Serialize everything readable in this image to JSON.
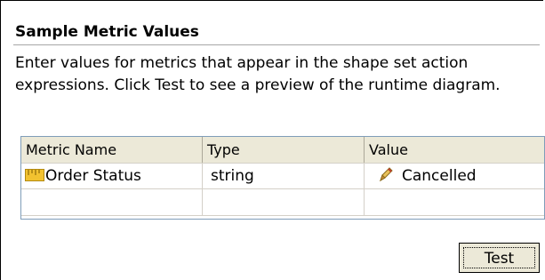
{
  "section": {
    "title": "Sample Metric Values",
    "description": "Enter values for metrics that appear in the shape set action expressions. Click Test to see a preview of the runtime diagram."
  },
  "table": {
    "columns": [
      "Metric Name",
      "Type",
      "Value"
    ],
    "rows": [
      {
        "name": "Order Status",
        "type": "string",
        "value": "Cancelled",
        "name_icon": "metric-ruler-icon",
        "value_icon": "pencil-icon"
      }
    ]
  },
  "actions": {
    "test_label": "Test"
  }
}
